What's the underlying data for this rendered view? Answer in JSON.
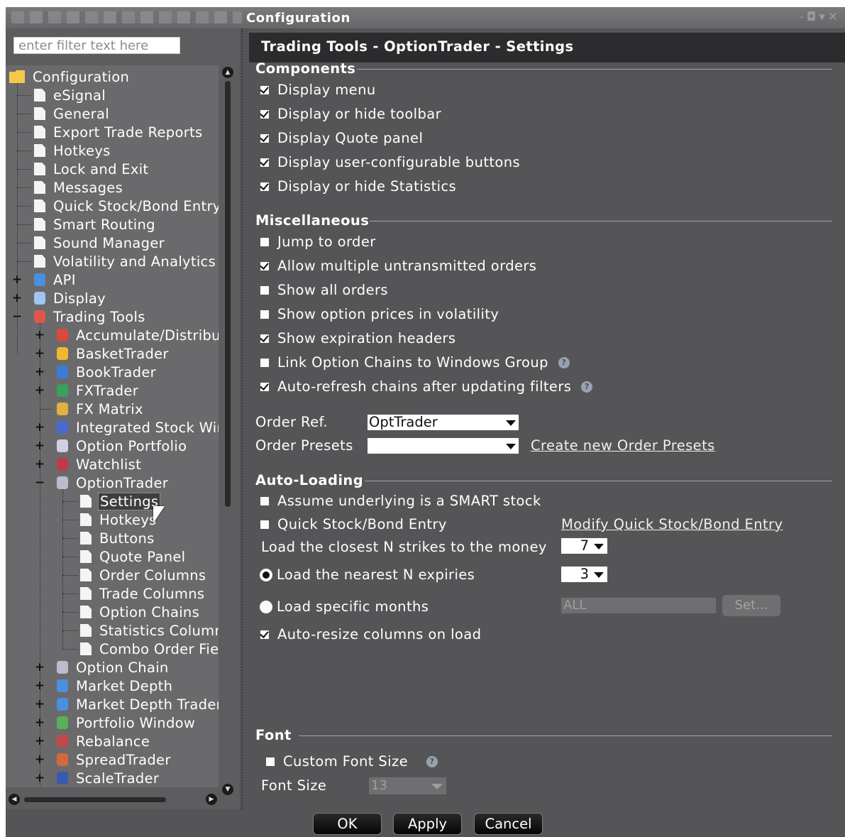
{
  "window": {
    "title": "Configuration"
  },
  "filter": {
    "placeholder": "enter filter text here"
  },
  "tree": {
    "root": "Configuration",
    "top_items": [
      "eSignal",
      "General",
      "Export Trade Reports",
      "Hotkeys",
      "Lock and Exit",
      "Messages",
      "Quick Stock/Bond Entry",
      "Smart Routing",
      "Sound Manager",
      "Volatility and Analytics"
    ],
    "api": "API",
    "display": "Display",
    "trading_tools": "Trading Tools",
    "tools": [
      {
        "label": "Accumulate/Distribute",
        "icon": "accumulate-icon"
      },
      {
        "label": "BasketTrader",
        "icon": "basket-icon"
      },
      {
        "label": "BookTrader",
        "icon": "book-icon"
      },
      {
        "label": "FXTrader",
        "icon": "fx-icon"
      },
      {
        "label": "FX Matrix",
        "icon": "fx-matrix-icon"
      },
      {
        "label": "Integrated Stock Window",
        "icon": "integrated-stock-icon"
      },
      {
        "label": "Option Portfolio",
        "icon": "option-portfolio-icon"
      },
      {
        "label": "Watchlist",
        "icon": "watchlist-icon"
      },
      {
        "label": "OptionTrader",
        "icon": "optiontrader-icon"
      }
    ],
    "optiontrader_children": [
      "Settings",
      "Hotkeys",
      "Buttons",
      "Quote Panel",
      "Order Columns",
      "Trade Columns",
      "Option Chains",
      "Statistics Columns",
      "Combo Order Fields"
    ],
    "after_items": [
      {
        "label": "Option Chain",
        "icon": "option-chain-icon"
      },
      {
        "label": "Market Depth",
        "icon": "market-depth-icon"
      },
      {
        "label": "Market Depth Trader",
        "icon": "market-depth-trader-icon"
      },
      {
        "label": "Portfolio Window",
        "icon": "portfolio-icon"
      },
      {
        "label": "Rebalance",
        "icon": "rebalance-icon"
      },
      {
        "label": "SpreadTrader",
        "icon": "spread-icon"
      },
      {
        "label": "ScaleTrader",
        "icon": "scale-icon"
      }
    ]
  },
  "panel": {
    "header": "Trading Tools - OptionTrader - Settings",
    "components": {
      "title": "Components",
      "options": [
        {
          "label": "Display menu",
          "checked": true
        },
        {
          "label": "Display or hide toolbar",
          "checked": true
        },
        {
          "label": "Display Quote panel",
          "checked": true
        },
        {
          "label": "Display user-configurable buttons",
          "checked": true
        },
        {
          "label": "Display or hide Statistics",
          "checked": true
        }
      ]
    },
    "misc": {
      "title": "Miscellaneous",
      "options": [
        {
          "label": "Jump to order",
          "checked": false
        },
        {
          "label": "Allow multiple untransmitted orders",
          "checked": true
        },
        {
          "label": "Show all orders",
          "checked": false
        },
        {
          "label": "Show option prices in volatility",
          "checked": false
        },
        {
          "label": "Show expiration headers",
          "checked": true
        },
        {
          "label": "Link Option Chains to Windows Group",
          "checked": false,
          "help": true
        },
        {
          "label": "Auto-refresh chains after updating filters",
          "checked": true,
          "help": true
        }
      ],
      "order_ref_label": "Order Ref.",
      "order_ref_value": "OptTrader",
      "order_presets_label": "Order Presets",
      "order_presets_value": "",
      "create_presets_link": "Create new Order Presets"
    },
    "autoload": {
      "title": "Auto-Loading",
      "assume_smart": "Assume underlying is a SMART stock",
      "quick_entry": "Quick Stock/Bond Entry",
      "modify_link": "Modify Quick Stock/Bond Entry",
      "closest_strikes_label": "Load the closest N strikes to the money",
      "closest_strikes_value": "7",
      "nearest_expiries_label": "Load the nearest N expiries",
      "nearest_expiries_value": "3",
      "specific_months_label": "Load specific months",
      "specific_months_value": "ALL",
      "set_button": "Set...",
      "auto_resize": "Auto-resize columns on load"
    },
    "font": {
      "title": "Font",
      "custom_font_size": "Custom Font Size",
      "font_size_label": "Font Size",
      "font_size_value": "13"
    }
  },
  "buttons": {
    "ok": "OK",
    "apply": "Apply",
    "cancel": "Cancel"
  },
  "colors": {
    "panel_bg": "#555557",
    "header_bg": "#2c2c2e",
    "tree_bg": "#6a6a6c",
    "folder": "#f5c84a"
  }
}
